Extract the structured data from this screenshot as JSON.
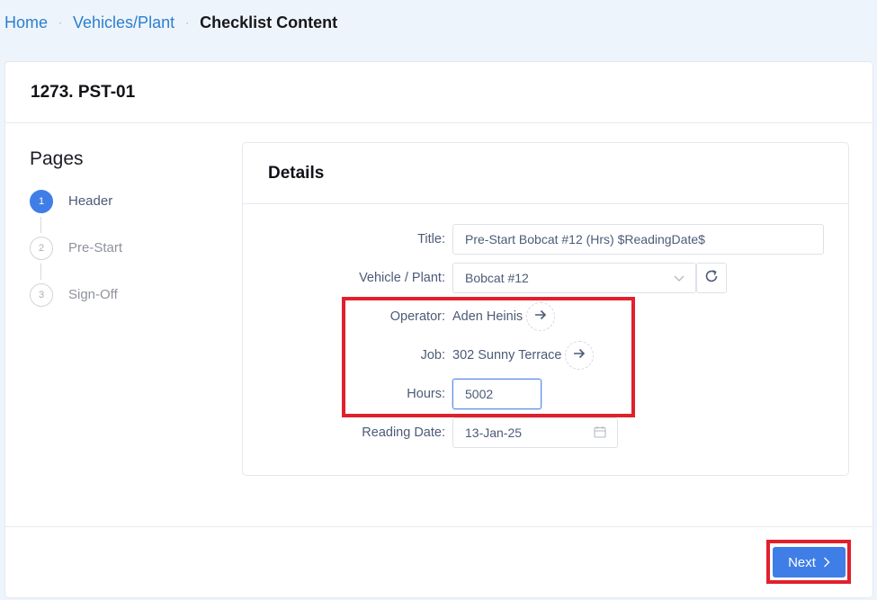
{
  "breadcrumb": {
    "home": "Home",
    "section": "Vehicles/Plant",
    "current": "Checklist Content",
    "sep": "·"
  },
  "card": {
    "title": "1273. PST-01"
  },
  "pages": {
    "title": "Pages",
    "steps": [
      {
        "num": "1",
        "label": "Header",
        "active": true
      },
      {
        "num": "2",
        "label": "Pre-Start",
        "active": false
      },
      {
        "num": "3",
        "label": "Sign-Off",
        "active": false
      }
    ]
  },
  "details": {
    "title": "Details",
    "fields": {
      "title": {
        "label": "Title",
        "value": "Pre-Start Bobcat #12 (Hrs) $ReadingDate$"
      },
      "vehicle": {
        "label": "Vehicle / Plant",
        "value": "Bobcat #12"
      },
      "operator": {
        "label": "Operator",
        "value": "Aden Heinis"
      },
      "job": {
        "label": "Job",
        "value": "302 Sunny Terrace"
      },
      "hours": {
        "label": "Hours",
        "value": "5002"
      },
      "reading_date": {
        "label": "Reading Date",
        "value": "13-Jan-25"
      }
    }
  },
  "footer": {
    "next_label": "Next"
  },
  "colors": {
    "accent": "#3f7ee6",
    "highlight": "#e0212d",
    "link": "#2b7fd0"
  }
}
